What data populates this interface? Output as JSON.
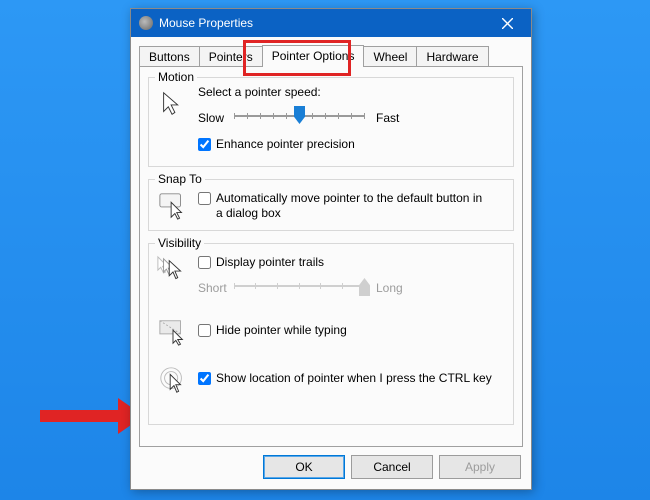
{
  "window": {
    "title": "Mouse Properties"
  },
  "tabs": {
    "t0": "Buttons",
    "t1": "Pointers",
    "t2": "Pointer Options",
    "t3": "Wheel",
    "t4": "Hardware"
  },
  "motion": {
    "legend": "Motion",
    "label": "Select a pointer speed:",
    "slow": "Slow",
    "fast": "Fast",
    "enhance": "Enhance pointer precision"
  },
  "snap": {
    "legend": "Snap To",
    "label": "Automatically move pointer to the default button in a dialog box"
  },
  "vis": {
    "legend": "Visibility",
    "trails": "Display pointer trails",
    "short": "Short",
    "long": "Long",
    "hide": "Hide pointer while typing",
    "ctrl": "Show location of pointer when I press the CTRL key"
  },
  "buttons": {
    "ok": "OK",
    "cancel": "Cancel",
    "apply": "Apply"
  }
}
